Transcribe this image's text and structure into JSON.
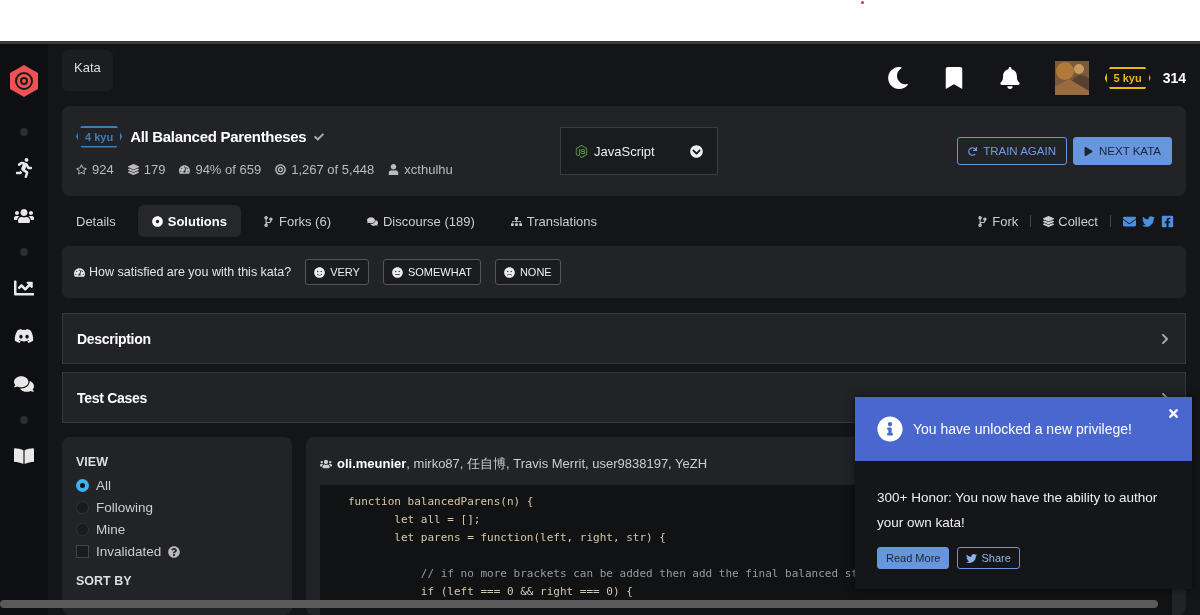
{
  "top_bar": {
    "breadcrumb": "Kata",
    "rank": "5 kyu",
    "honor": "314"
  },
  "kata": {
    "rank": "4 kyu",
    "title": "All Balanced Parentheses",
    "completed": true,
    "stats": [
      {
        "kind": "stars",
        "text": "924"
      },
      {
        "kind": "collections",
        "text": "179"
      },
      {
        "kind": "satisfaction",
        "text": "94% of 659"
      },
      {
        "kind": "completions",
        "text": "1,267 of 5,448"
      },
      {
        "kind": "author",
        "text": "xcthulhu"
      }
    ],
    "language": "JavaScript",
    "actions": [
      {
        "kind": "outline",
        "label": "TRAIN AGAIN"
      },
      {
        "kind": "filled",
        "label": "NEXT KATA"
      }
    ]
  },
  "tabs": [
    {
      "kind": "details",
      "label": "Details",
      "selected": false
    },
    {
      "kind": "solutions",
      "label": "Solutions",
      "selected": true
    },
    {
      "kind": "forks",
      "label": "Forks (6)",
      "selected": false
    },
    {
      "kind": "discourse",
      "label": "Discourse (189)",
      "selected": false
    },
    {
      "kind": "translations",
      "label": "Translations",
      "selected": false
    }
  ],
  "links": [
    {
      "kind": "fork",
      "label": "Fork"
    },
    {
      "kind": "collect",
      "label": "Collect"
    }
  ],
  "feedback": {
    "question": "How satisfied are you with this kata?",
    "options": [
      {
        "kind": "happy",
        "label": "VERY"
      },
      {
        "kind": "neutral",
        "label": "SOMEWHAT"
      },
      {
        "kind": "sad",
        "label": "NONE"
      }
    ]
  },
  "sections": [
    {
      "title": "Description",
      "expanded": false
    },
    {
      "title": "Test Cases",
      "expanded": false
    }
  ],
  "filters": {
    "view_title": "VIEW",
    "view": [
      {
        "label": "All",
        "selected": true
      },
      {
        "label": "Following",
        "selected": false
      },
      {
        "label": "Mine",
        "selected": false
      }
    ],
    "invalidated": {
      "label": "Invalidated",
      "checked": false
    },
    "sort_title": "SORT BY"
  },
  "solution": {
    "authors": "**oli.meunier**, mirko87, 任自博, Travis Merrit, user9838197, YeZH",
    "code": [
      {
        "kind": "code",
        "text": "function balancedParens(n) {"
      },
      {
        "kind": "code",
        "text": "       let all = [];"
      },
      {
        "kind": "code",
        "text": "       let parens = function(left, right, str) {"
      },
      {
        "kind": "blank"
      },
      {
        "kind": "comment",
        "text": "           // if no more brackets can be added then add the final balanced st"
      },
      {
        "kind": "code",
        "text": "           if (left === 0 && right === 0) {"
      }
    ]
  },
  "toast": {
    "title": "You have unlocked a new privilege!",
    "message": "300+ Honor: You now have the ability to author your own kata!",
    "buttons": [
      {
        "kind": "filled",
        "label": "Read More"
      },
      {
        "kind": "twitter",
        "label": "Share"
      }
    ]
  }
}
